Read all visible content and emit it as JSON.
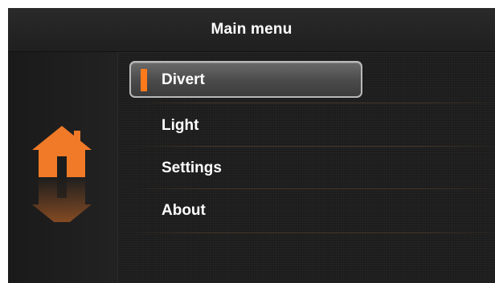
{
  "header": {
    "title": "Main menu"
  },
  "sidebar": {
    "icon": "home-icon",
    "accent_color": "#f07a28"
  },
  "menu": {
    "selected_index": 0,
    "items": [
      {
        "label": "Divert"
      },
      {
        "label": "Light"
      },
      {
        "label": "Settings"
      },
      {
        "label": "About"
      }
    ]
  },
  "colors": {
    "background": "#1c1c1c",
    "text": "#ffffff",
    "selection_marker": "#ff7a1a",
    "selection_border": "#b9b9b9"
  }
}
